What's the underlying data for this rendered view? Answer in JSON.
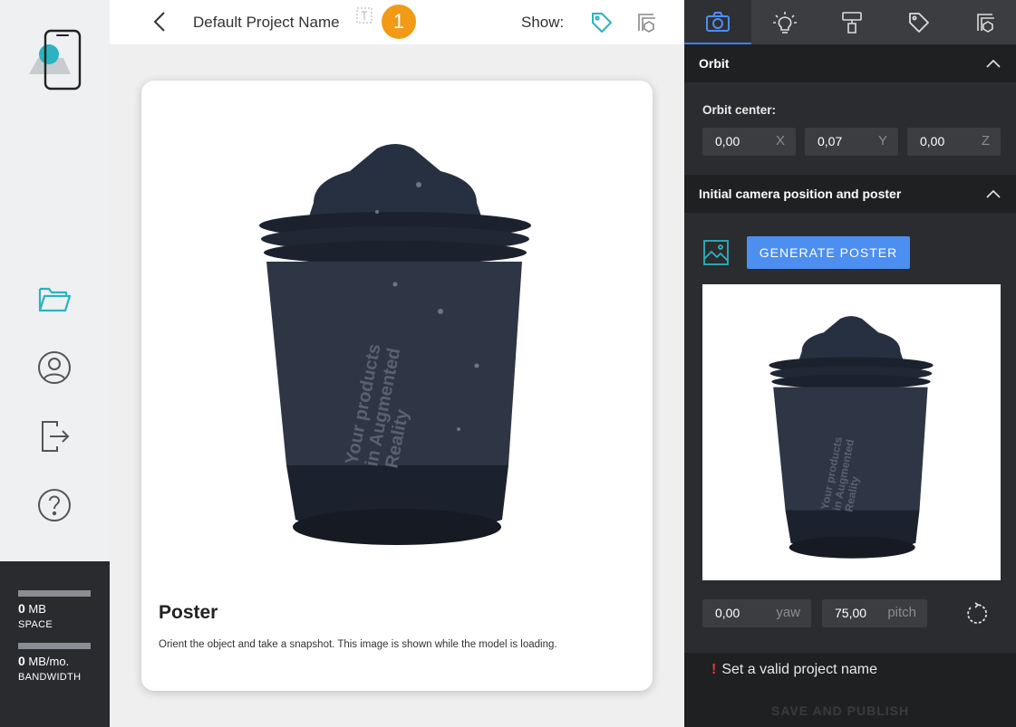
{
  "usage": {
    "space_value": "0",
    "space_unit": "MB",
    "space_label": "SPACE",
    "bandwidth_value": "0",
    "bandwidth_unit": "MB/mo.",
    "bandwidth_label": "BANDWIDTH"
  },
  "header": {
    "project_name": "Default Project Name",
    "step_badge": "1",
    "show_label": "Show:"
  },
  "card": {
    "title": "Poster",
    "description": "Orient the object and take a snapshot. This image is shown while the model is loading."
  },
  "panel": {
    "tabs": [
      "camera",
      "lighting",
      "material",
      "tag",
      "ar"
    ],
    "active_tab": "camera",
    "orbit_section": "Orbit",
    "orbit_center_label": "Orbit center:",
    "orbit_center": [
      {
        "value": "0,00",
        "axis": "X"
      },
      {
        "value": "0,07",
        "axis": "Y"
      },
      {
        "value": "0,00",
        "axis": "Z"
      }
    ],
    "camera_section": "Initial camera position and poster",
    "generate_label": "GENERATE POSTER",
    "yaw_value": "0,00",
    "yaw_unit": "yaw",
    "pitch_value": "75,00",
    "pitch_unit": "pitch",
    "warning": "Set a valid project name",
    "warning_mark": "!",
    "publish_label": "SAVE AND PUBLISH"
  },
  "colors": {
    "accent_blue": "#4d8ef1",
    "teal": "#2bb3c0",
    "badge_orange": "#f19a15",
    "panel_dark": "#2b2c2f"
  }
}
